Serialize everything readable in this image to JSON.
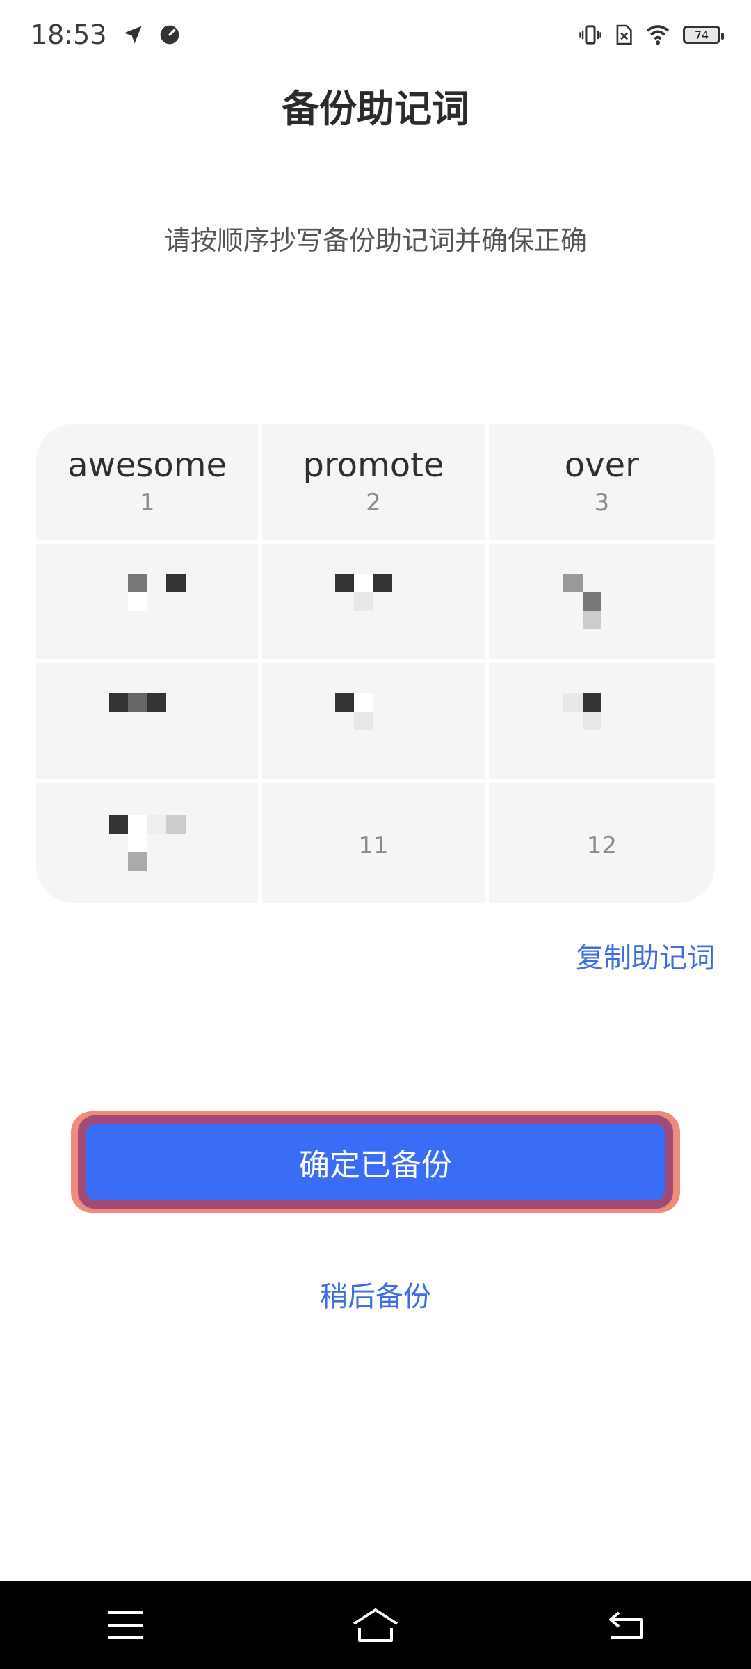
{
  "status_bar": {
    "time": "18:53",
    "icons": [
      "send-icon",
      "speedometer-icon",
      "vibrate-icon",
      "no-sim-icon",
      "wifi-icon"
    ],
    "battery": "74"
  },
  "header": {
    "title": "备份助记词"
  },
  "instructions": "请按顺序抄写备份助记词并确保正确",
  "mnemonic": {
    "words": [
      {
        "index": "1",
        "word": "awesome"
      },
      {
        "index": "2",
        "word": "promote"
      },
      {
        "index": "3",
        "word": "over"
      },
      {
        "index": "11",
        "word": ""
      },
      {
        "index": "12",
        "word": ""
      }
    ],
    "copy_label": "复制助记词"
  },
  "actions": {
    "confirm_label": "确定已备份",
    "later_label": "稍后备份"
  },
  "nav_bar": {
    "buttons": [
      "menu-icon",
      "home-icon",
      "back-icon"
    ]
  },
  "colors": {
    "accent": "#3a6df5",
    "link": "#3d6fe0",
    "card_bg": "#f4f5f7"
  }
}
